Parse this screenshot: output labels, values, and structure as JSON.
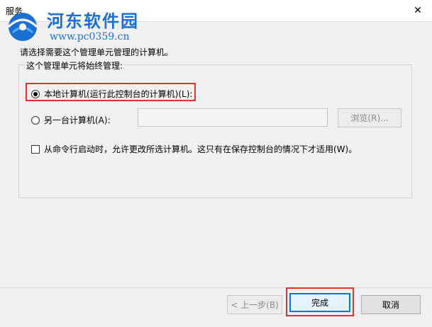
{
  "window": {
    "title": "服务"
  },
  "watermark": {
    "name": "河东软件园",
    "url": "www.pc0359.cn"
  },
  "dialog": {
    "prompt": "请选择需要这个管理单元管理的计算机。",
    "group_title": "这个管理单元将始终管理:",
    "option_local": "本地计算机(运行此控制台的计算机)(L):",
    "option_local_selected": true,
    "option_other": "另一台计算机(A):",
    "other_value": "",
    "browse_label": "浏览(R)...",
    "checkbox_label": "从命令行启动时，允许更改所选计算机。这只有在保存控制台的情况下才适用(W)。",
    "checkbox_checked": false
  },
  "footer": {
    "back_label": "< 上一步(B)",
    "finish_label": "完成",
    "cancel_label": "取消"
  },
  "colors": {
    "highlight": "#e03030",
    "watermark": "#1a6fd1"
  }
}
